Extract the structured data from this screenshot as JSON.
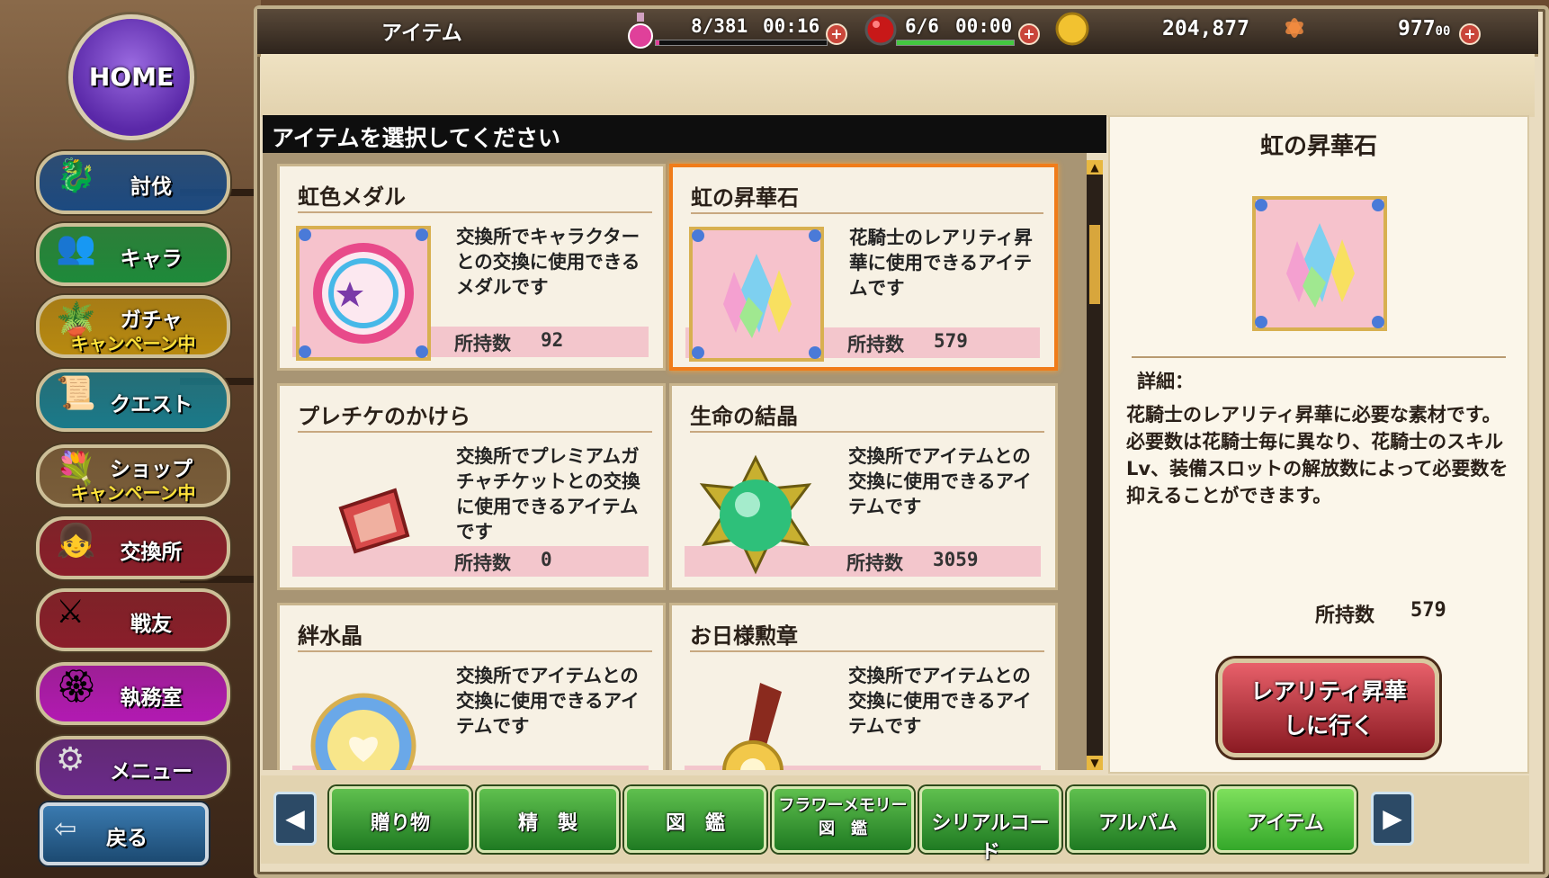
{
  "header": {
    "screen_title": "アイテム",
    "stamina": {
      "value": "8/381",
      "timer": "00:16",
      "level": 0.02
    },
    "battle": {
      "value": "6/6",
      "timer": "00:00",
      "level": 1.0
    },
    "gold": "204,877",
    "gems_main": "977",
    "gems_sub": "00",
    "colors": {
      "stamina": "#e0409a",
      "battle": "#44c840",
      "gold": "#f2c230"
    }
  },
  "sidebar": {
    "home_label": "HOME",
    "items": [
      {
        "label": "討伐",
        "icon": "dragon-icon",
        "color": "#1c4a80"
      },
      {
        "label": "キャラ",
        "icon": "characters-icon",
        "color": "#1e8a3a"
      },
      {
        "label": "ガチャ",
        "sub": "キャンペーン中",
        "icon": "pot-icon",
        "color": "#b88a10"
      },
      {
        "label": "クエスト",
        "icon": "quest-book-icon",
        "color": "#1a7a8a"
      },
      {
        "label": "ショップ",
        "sub": "キャンペーン中",
        "icon": "flower-shop-icon",
        "color": "#7a5e3a"
      },
      {
        "label": "交換所",
        "icon": "girl-icon",
        "color": "#8a1e2a"
      },
      {
        "label": "戦友",
        "icon": "crossed-swords-icon",
        "color": "#8a1e2a"
      },
      {
        "label": "執務室",
        "icon": "banner-icon",
        "color": "#b21ab2"
      },
      {
        "label": "メニュー",
        "icon": "gear-icon",
        "color": "#6a2a8a"
      }
    ],
    "back_label": "戻る"
  },
  "list": {
    "heading": "アイテムを選択してください",
    "count_label": "所持数",
    "items": [
      {
        "name": "虹色メダル",
        "desc": "交換所でキャラクターとの交換に使用できるメダルです",
        "count": "92",
        "icon": "rainbow-medal-icon"
      },
      {
        "name": "虹の昇華石",
        "desc": "花騎士のレアリティ昇華に使用できるアイテムです",
        "count": "579",
        "icon": "rainbow-crystal-icon",
        "selected": true
      },
      {
        "name": "プレチケのかけら",
        "desc": "交換所でプレミアムガチャチケットとの交換に使用できるアイテムです",
        "count": "0",
        "icon": "ticket-fragment-icon"
      },
      {
        "name": "生命の結晶",
        "desc": "交換所でアイテムとの交換に使用できるアイテムです",
        "count": "3059",
        "icon": "life-crystal-icon"
      },
      {
        "name": "絆水晶",
        "desc": "交換所でアイテムとの交換に使用できるアイテムです",
        "count": "",
        "icon": "bond-crystal-icon"
      },
      {
        "name": "お日様勲章",
        "desc": "交換所でアイテムとの交換に使用できるアイテムです",
        "count": "",
        "icon": "sun-medal-icon"
      }
    ]
  },
  "detail": {
    "title": "虹の昇華石",
    "detail_label": "詳細：",
    "description": "花騎士のレアリティ昇華に必要な素材です。\n必要数は花騎士毎に異なり、花騎士のスキルLv、装備スロットの解放数によって必要数を抑えることができます。",
    "count_label": "所持数",
    "count": "579",
    "action_line1": "レアリティ昇華",
    "action_line2": "しに行く"
  },
  "tabs": [
    {
      "label": "贈り物"
    },
    {
      "label": "精　製"
    },
    {
      "label": "図　鑑"
    },
    {
      "label": "フラワーメモリー",
      "label2": "図　鑑"
    },
    {
      "label": "シリアルコード"
    },
    {
      "label": "アルバム"
    },
    {
      "label": "アイテム",
      "active": true
    }
  ]
}
